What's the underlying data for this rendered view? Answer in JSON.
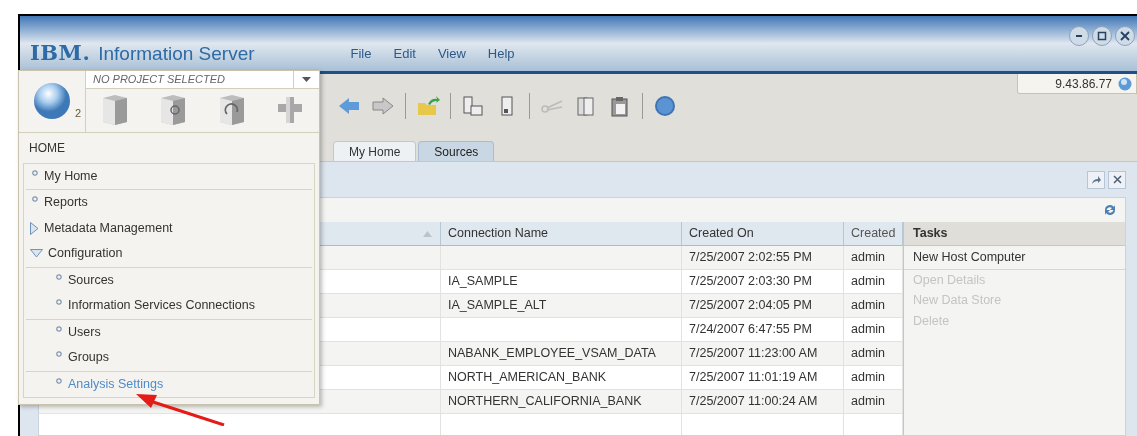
{
  "window": {
    "logo": "IBM.",
    "title": "Information Server",
    "menu": [
      "File",
      "Edit",
      "View",
      "Help"
    ],
    "server": "9.43.86.77"
  },
  "project": {
    "label": "NO PROJECT SELECTED",
    "badge": "2"
  },
  "home_menu": {
    "title": "HOME",
    "items": [
      {
        "label": "My Home",
        "separated": false,
        "selected": false
      },
      {
        "label": "Reports",
        "separated": true,
        "selected": false
      },
      {
        "label": "Metadata Management",
        "separated": false,
        "expanded": false,
        "selected": false
      },
      {
        "label": "Configuration",
        "separated": false,
        "expanded": true,
        "selected": false,
        "children": [
          {
            "label": "Sources",
            "separated": true,
            "selected": false
          },
          {
            "label": "Information Services Connections",
            "separated": false,
            "selected": false
          },
          {
            "label": "Users",
            "separated": true,
            "selected": false
          },
          {
            "label": "Groups",
            "separated": false,
            "selected": false
          },
          {
            "label": "Analysis Settings",
            "separated": true,
            "selected": true
          }
        ]
      }
    ]
  },
  "tabs": [
    {
      "label": "My Home",
      "selected": false
    },
    {
      "label": "Sources",
      "selected": true
    }
  ],
  "table": {
    "columns": [
      "Connection Name",
      "Created On",
      "Created"
    ],
    "rows": [
      {
        "connection_name": "",
        "created_on": "7/25/2007 2:02:55 PM",
        "created": "admin"
      },
      {
        "connection_name": "IA_SAMPLE",
        "created_on": "7/25/2007 2:03:30 PM",
        "created": "admin"
      },
      {
        "connection_name": "IA_SAMPLE_ALT",
        "created_on": "7/25/2007 2:04:05 PM",
        "created": "admin"
      },
      {
        "connection_name": "",
        "created_on": "7/24/2007 6:47:55 PM",
        "created": "admin"
      },
      {
        "connection_name": "NABANK_EMPLOYEE_VSAM_DATA",
        "created_on": "7/25/2007 11:23:00 AM",
        "created": "admin"
      },
      {
        "connection_name": "NORTH_AMERICAN_BANK",
        "created_on": "7/25/2007 11:01:19 AM",
        "created": "admin"
      },
      {
        "connection_name": "NORTHERN_CALIFORNIA_BANK",
        "created_on": "7/25/2007 11:00:24 AM",
        "created": "admin"
      }
    ]
  },
  "tasks": {
    "title": "Tasks",
    "items": [
      {
        "label": "New Host Computer",
        "disabled": false
      },
      {
        "label": "Open Details",
        "disabled": true
      },
      {
        "label": "New Data Store",
        "disabled": true
      },
      {
        "label": "Delete",
        "disabled": true
      }
    ]
  }
}
